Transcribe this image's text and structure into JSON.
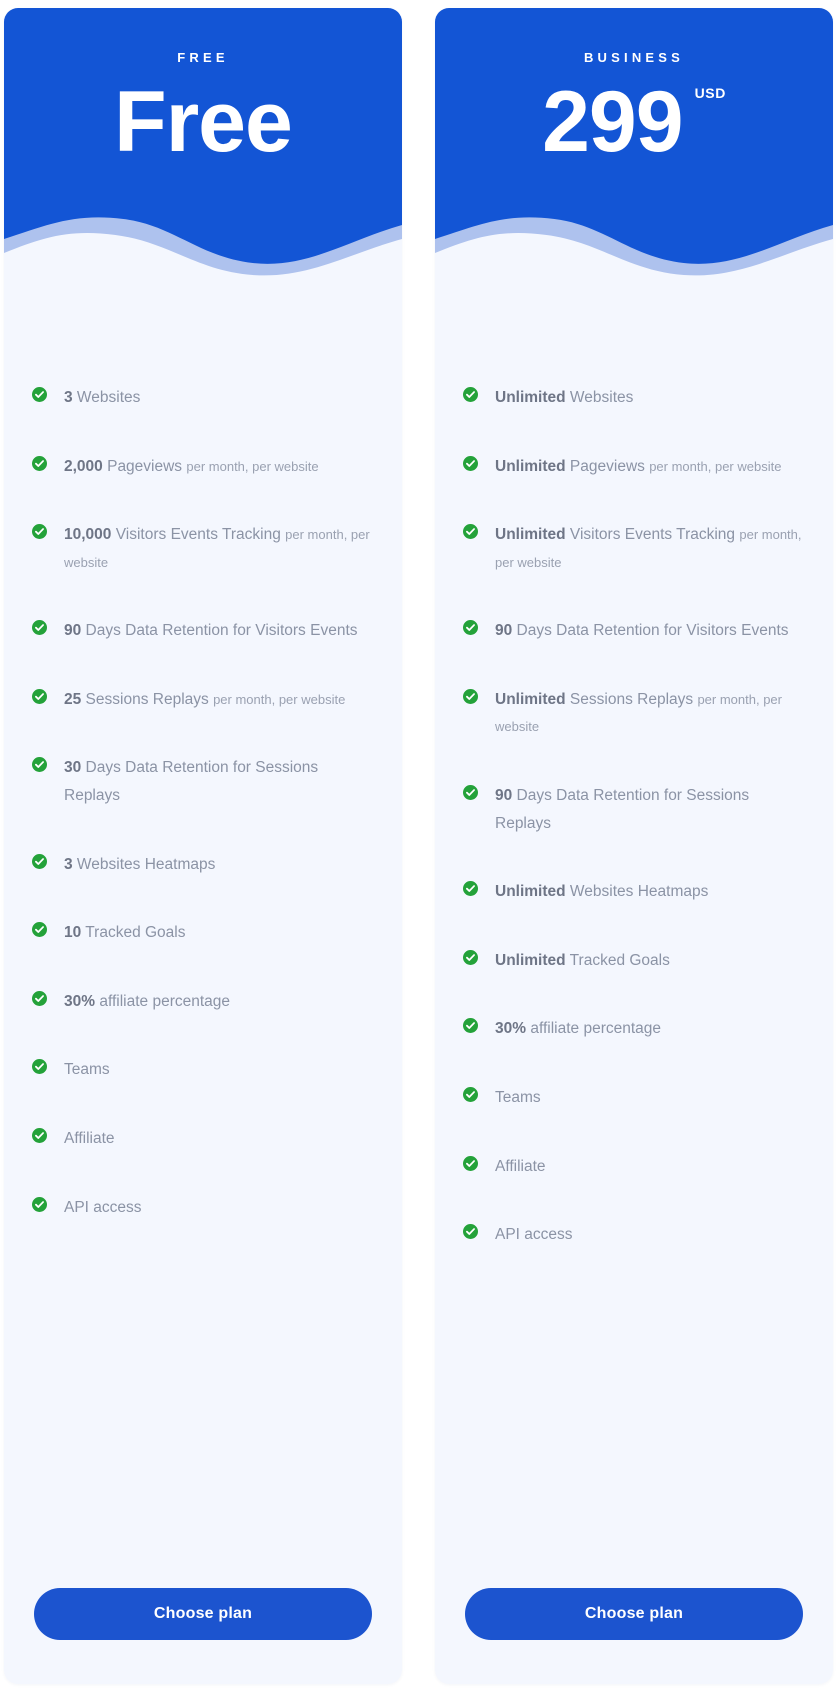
{
  "theme": {
    "brand_blue": "#1355d5",
    "button_blue": "#1c54cf",
    "card_bg": "#f4f7fe",
    "wave_mid": "#aec2ee",
    "wave_front": "#f4f7fe",
    "check_green": "#24a23a",
    "text_gray": "#8b93a5",
    "value_gray": "#6e7586"
  },
  "plans": [
    {
      "id": "free",
      "label": "FREE",
      "price": "Free",
      "currency": "",
      "cta": "Choose plan",
      "features": [
        {
          "value": "3",
          "label": " Websites",
          "note": ""
        },
        {
          "value": "2,000",
          "label": " Pageviews ",
          "note": "per month, per website"
        },
        {
          "value": "10,000",
          "label": " Visitors Events Tracking ",
          "note": "per month, per website"
        },
        {
          "value": "90",
          "label": " Days Data Retention for Visitors Events",
          "note": ""
        },
        {
          "value": "25",
          "label": " Sessions Replays ",
          "note": "per month, per website"
        },
        {
          "value": "30",
          "label": " Days Data Retention for Sessions Replays",
          "note": ""
        },
        {
          "value": "3",
          "label": " Websites Heatmaps",
          "note": ""
        },
        {
          "value": "10",
          "label": " Tracked Goals",
          "note": ""
        },
        {
          "value": "30%",
          "label": " affiliate percentage",
          "note": ""
        },
        {
          "value": "",
          "label": "Teams",
          "note": ""
        },
        {
          "value": "",
          "label": "Affiliate",
          "note": ""
        },
        {
          "value": "",
          "label": "API access",
          "note": ""
        }
      ]
    },
    {
      "id": "business",
      "label": "BUSINESS",
      "price": "299",
      "currency": "USD",
      "cta": "Choose plan",
      "features": [
        {
          "value": "Unlimited",
          "label": " Websites",
          "note": ""
        },
        {
          "value": "Unlimited",
          "label": " Pageviews ",
          "note": "per month, per website"
        },
        {
          "value": "Unlimited",
          "label": " Visitors Events Tracking ",
          "note": "per month, per website"
        },
        {
          "value": "90",
          "label": " Days Data Retention for Visitors Events",
          "note": ""
        },
        {
          "value": "Unlimited",
          "label": " Sessions Replays ",
          "note": "per month, per website"
        },
        {
          "value": "90",
          "label": " Days Data Retention for Sessions Replays",
          "note": ""
        },
        {
          "value": "Unlimited",
          "label": " Websites Heatmaps",
          "note": ""
        },
        {
          "value": "Unlimited",
          "label": " Tracked Goals",
          "note": ""
        },
        {
          "value": "30%",
          "label": " affiliate percentage",
          "note": ""
        },
        {
          "value": "",
          "label": "Teams",
          "note": ""
        },
        {
          "value": "",
          "label": "Affiliate",
          "note": ""
        },
        {
          "value": "",
          "label": "API access",
          "note": ""
        }
      ]
    }
  ],
  "icons": {
    "check": "check-circle-icon"
  }
}
